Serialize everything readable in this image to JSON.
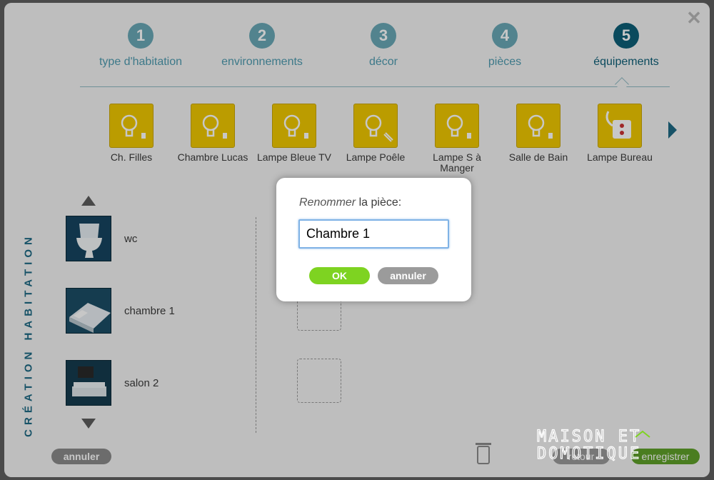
{
  "steps": [
    {
      "number": "1",
      "label": "type d'habitation"
    },
    {
      "number": "2",
      "label": "environnements"
    },
    {
      "number": "3",
      "label": "décor"
    },
    {
      "number": "4",
      "label": "pièces"
    },
    {
      "number": "5",
      "label": "équipements"
    }
  ],
  "equipment": [
    {
      "name": "Ch. Filles",
      "icon": "bulb-icon"
    },
    {
      "name": "Chambre Lucas",
      "icon": "bulb-icon"
    },
    {
      "name": "Lampe Bleue TV",
      "icon": "bulb-icon"
    },
    {
      "name": "Lampe Poêle",
      "icon": "bulb-icon"
    },
    {
      "name": "Lampe S à Manger",
      "icon": "bulb-icon"
    },
    {
      "name": "Salle de Bain",
      "icon": "bulb-icon"
    },
    {
      "name": "Lampe Bureau",
      "icon": "plug-icon"
    }
  ],
  "side_title": "CRÉATION HABITATION",
  "rooms": [
    {
      "name": "wc",
      "icon": "toilet-icon"
    },
    {
      "name": "chambre 1",
      "icon": "bed-icon"
    },
    {
      "name": "salon 2",
      "icon": "sofa-icon"
    }
  ],
  "footer": {
    "cancel_label": "annuler",
    "back_label": "retour",
    "save_label": "enregistrer"
  },
  "watermark": {
    "line1": "MAISON ET",
    "line2": "DOMOTIQUE"
  },
  "modal": {
    "title_italic": "Renommer",
    "title_rest": " la pièce:",
    "input_value": "Chambre 1",
    "ok_label": "OK",
    "cancel_label": "annuler"
  },
  "colors": {
    "accent": "#0e5f78",
    "tile": "#f0c800",
    "ok": "#7ed321"
  }
}
